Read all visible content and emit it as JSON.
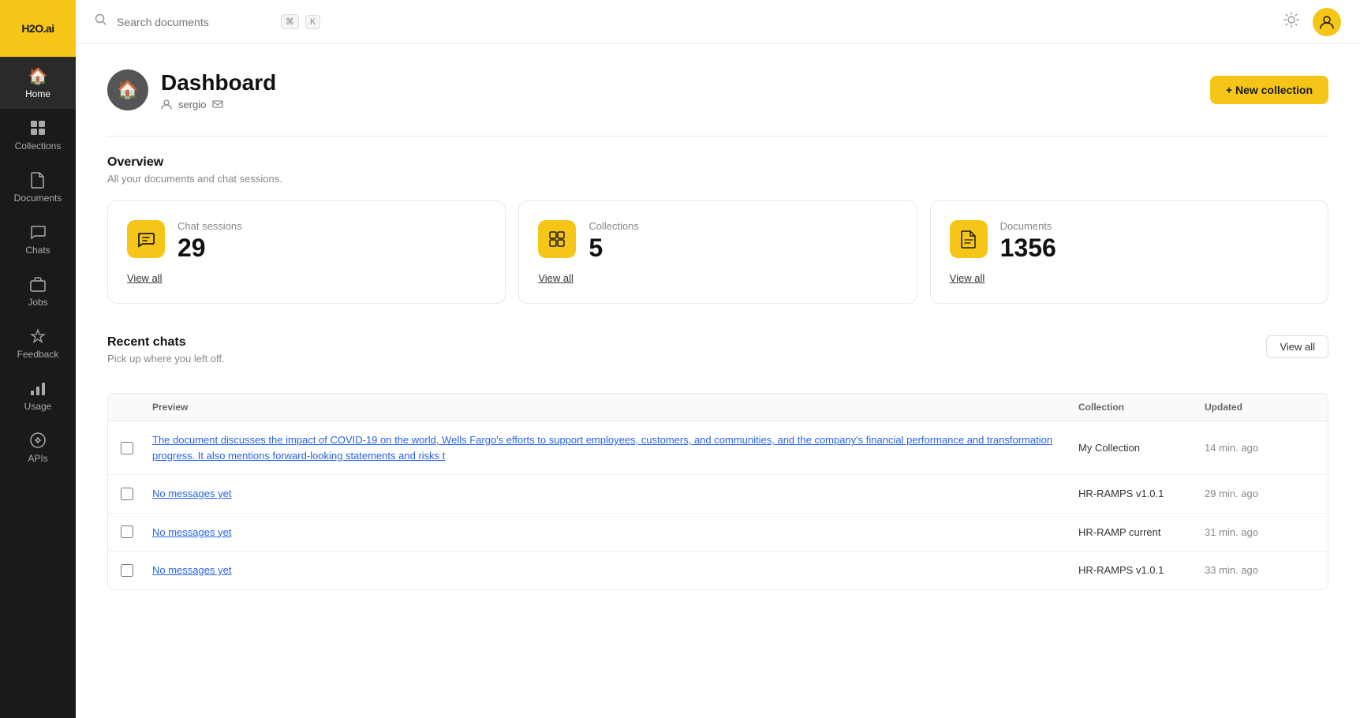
{
  "app": {
    "logo": "H2O.ai"
  },
  "sidebar": {
    "items": [
      {
        "id": "home",
        "label": "Home",
        "icon": "🏠",
        "active": true
      },
      {
        "id": "collections",
        "label": "Collections",
        "icon": "⊞",
        "active": false
      },
      {
        "id": "documents",
        "label": "Documents",
        "icon": "📄",
        "active": false
      },
      {
        "id": "chats",
        "label": "Chats",
        "icon": "💬",
        "active": false
      },
      {
        "id": "jobs",
        "label": "Jobs",
        "icon": "💼",
        "active": false
      },
      {
        "id": "feedback",
        "label": "Feedback",
        "icon": "👍",
        "active": false
      },
      {
        "id": "usage",
        "label": "Usage",
        "icon": "📊",
        "active": false
      },
      {
        "id": "apis",
        "label": "APIs",
        "icon": "⚙️",
        "active": false
      }
    ]
  },
  "topbar": {
    "search_placeholder": "Search documents",
    "kbd1": "⌘",
    "kbd2": "K"
  },
  "dashboard": {
    "title": "Dashboard",
    "username": "sergio",
    "new_collection_label": "+ New collection"
  },
  "overview": {
    "title": "Overview",
    "subtitle": "All your documents and chat sessions.",
    "stats": [
      {
        "id": "chat-sessions",
        "label": "Chat sessions",
        "value": "29",
        "view_all": "View all",
        "icon": "💬"
      },
      {
        "id": "collections",
        "label": "Collections",
        "value": "5",
        "view_all": "View all",
        "icon": "⊞"
      },
      {
        "id": "documents",
        "label": "Documents",
        "value": "1356",
        "view_all": "View all",
        "icon": "📄"
      }
    ]
  },
  "recent_chats": {
    "title": "Recent chats",
    "subtitle": "Pick up where you left off.",
    "view_all_label": "View all",
    "table": {
      "headers": [
        "",
        "Preview",
        "Collection",
        "Updated"
      ],
      "rows": [
        {
          "preview": "The document discusses the impact of COVID-19 on the world, Wells Fargo's efforts to support employees, customers, and communities, and the company's financial performance and transformation progress. It also mentions forward-looking statements and risks t",
          "collection": "My Collection",
          "updated": "14 min. ago"
        },
        {
          "preview": "No messages yet",
          "collection": "HR-RAMPS v1.0.1",
          "updated": "29 min. ago"
        },
        {
          "preview": "No messages yet",
          "collection": "HR-RAMP current",
          "updated": "31 min. ago"
        },
        {
          "preview": "No messages yet",
          "collection": "HR-RAMPS v1.0.1",
          "updated": "33 min. ago"
        }
      ]
    }
  },
  "colors": {
    "accent": "#f5c518",
    "sidebar_bg": "#1a1a1a",
    "link_color": "#2563eb"
  }
}
